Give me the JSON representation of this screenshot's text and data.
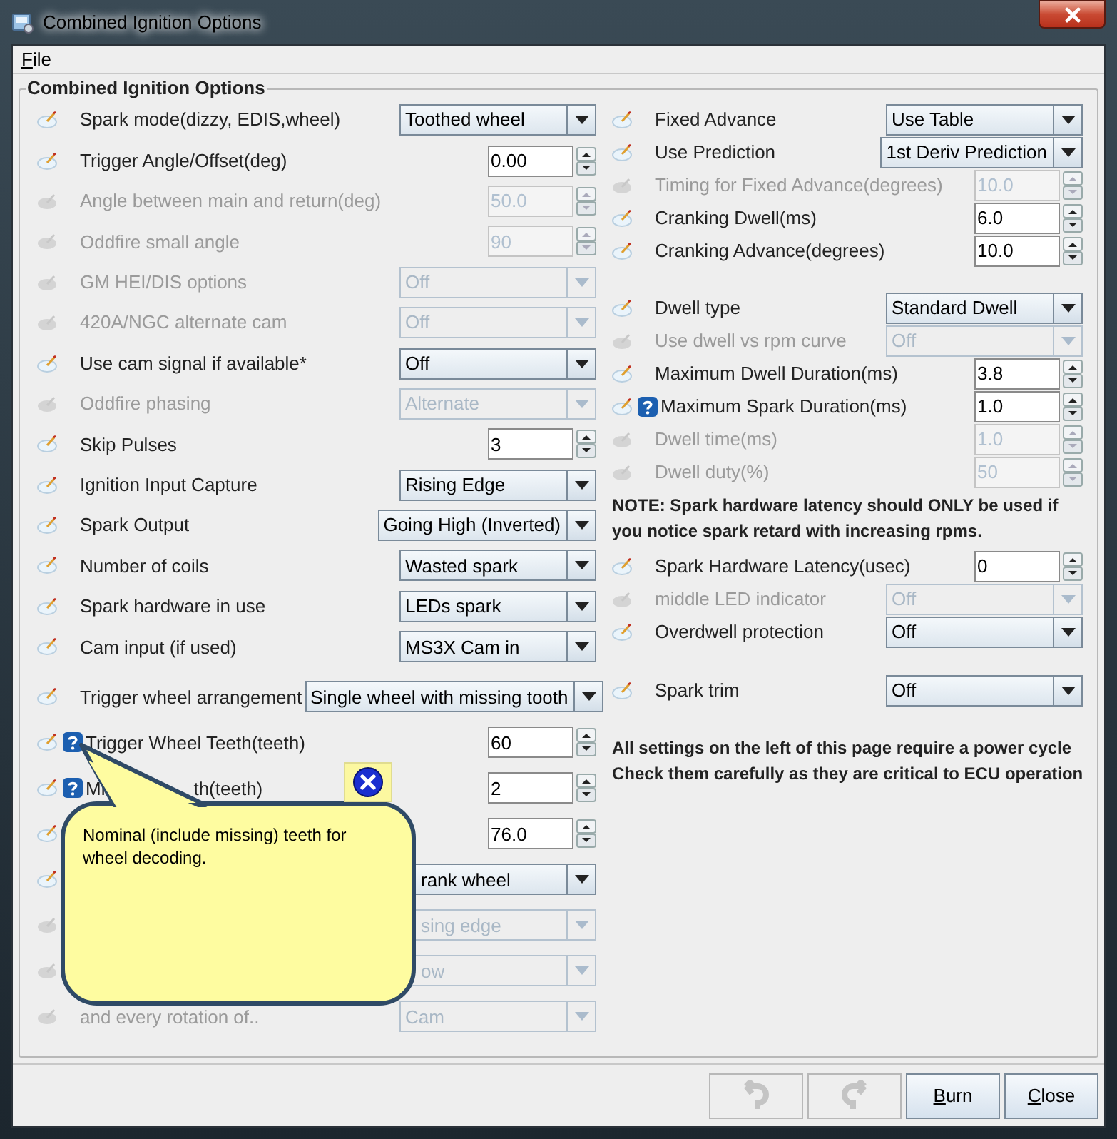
{
  "window": {
    "title": "Combined Ignition Options"
  },
  "menu": [
    {
      "label": "File",
      "underline_first": true
    }
  ],
  "group_title": "Combined Ignition Options",
  "left_groups": [
    [
      {
        "label": "Spark mode(dizzy, EDIS,wheel)",
        "enabled": true,
        "help": false,
        "control": {
          "kind": "combo",
          "value": "Toothed wheel"
        }
      },
      {
        "label": "Trigger Angle/Offset(deg)",
        "enabled": true,
        "help": false,
        "control": {
          "kind": "spinner",
          "value": "0.00"
        }
      },
      {
        "label": "Angle between main and return(deg)",
        "enabled": false,
        "help": false,
        "control": {
          "kind": "spinner",
          "value": "50.0"
        }
      },
      {
        "label": "Oddfire small angle",
        "enabled": false,
        "help": false,
        "control": {
          "kind": "spinner",
          "value": "90"
        }
      },
      {
        "label": "GM HEI/DIS options",
        "enabled": false,
        "help": false,
        "control": {
          "kind": "combo",
          "value": "Off"
        }
      },
      {
        "label": "420A/NGC alternate cam",
        "enabled": false,
        "help": false,
        "control": {
          "kind": "combo",
          "value": "Off"
        }
      },
      {
        "label": "Use cam signal if available*",
        "enabled": true,
        "help": false,
        "control": {
          "kind": "combo",
          "value": "Off"
        }
      },
      {
        "label": "Oddfire phasing",
        "enabled": false,
        "help": false,
        "control": {
          "kind": "combo",
          "value": "Alternate"
        }
      },
      {
        "label": "Skip Pulses",
        "enabled": true,
        "help": false,
        "control": {
          "kind": "spinner",
          "value": "3"
        }
      },
      {
        "label": "Ignition Input Capture",
        "enabled": true,
        "help": false,
        "control": {
          "kind": "combo",
          "value": "Rising Edge"
        }
      },
      {
        "label": "Spark Output",
        "enabled": true,
        "help": false,
        "control": {
          "kind": "combo",
          "value": "Going High (Inverted)"
        }
      },
      {
        "label": "Number of coils",
        "enabled": true,
        "help": false,
        "control": {
          "kind": "combo",
          "value": "Wasted spark"
        }
      },
      {
        "label": "Spark hardware in use",
        "enabled": true,
        "help": false,
        "control": {
          "kind": "combo",
          "value": "LEDs spark"
        }
      },
      {
        "label": "Cam input (if used)",
        "enabled": true,
        "help": false,
        "control": {
          "kind": "combo",
          "value": "MS3X Cam in"
        }
      }
    ],
    [
      {
        "label": "Trigger wheel arrangement",
        "enabled": true,
        "help": false,
        "control": {
          "kind": "combo",
          "value": "Single wheel with missing tooth"
        }
      },
      {
        "label": "Trigger Wheel Teeth(teeth)",
        "enabled": true,
        "help": true,
        "control": {
          "kind": "spinner",
          "value": "60"
        }
      },
      {
        "label_parts": [
          "Mi",
          "th(teeth)"
        ],
        "enabled": true,
        "help": true,
        "control": {
          "kind": "spinner",
          "value": "2"
        }
      },
      {
        "enabled": true,
        "help": false,
        "control": {
          "kind": "spinner",
          "value": "76.0"
        }
      },
      {
        "enabled": true,
        "help": false,
        "control": {
          "kind": "combo",
          "value": "rank wheel",
          "covered": true
        }
      },
      {
        "enabled": false,
        "help": false,
        "control": {
          "kind": "combo",
          "value": "sing edge",
          "covered": true
        }
      },
      {
        "enabled": false,
        "help": false,
        "control": {
          "kind": "combo",
          "value": "ow",
          "covered": true
        }
      },
      {
        "label": "and every rotation of..",
        "enabled": false,
        "help": false,
        "control": {
          "kind": "combo",
          "value": "Cam"
        }
      }
    ]
  ],
  "right_sections": [
    {
      "rows": [
        {
          "label": "Fixed Advance",
          "enabled": true,
          "help": false,
          "control": {
            "kind": "combo",
            "value": "Use Table"
          }
        },
        {
          "label": "Use Prediction",
          "enabled": true,
          "help": false,
          "control": {
            "kind": "combo",
            "value": "1st Deriv Prediction"
          }
        },
        {
          "label": "Timing for Fixed Advance(degrees)",
          "enabled": false,
          "help": false,
          "control": {
            "kind": "spinner",
            "value": "10.0"
          }
        },
        {
          "label": "Cranking Dwell(ms)",
          "enabled": true,
          "help": false,
          "control": {
            "kind": "spinner",
            "value": "6.0"
          }
        },
        {
          "label": "Cranking Advance(degrees)",
          "enabled": true,
          "help": false,
          "control": {
            "kind": "spinner",
            "value": "10.0"
          }
        }
      ]
    },
    {
      "rows": [
        {
          "label": "Dwell type",
          "enabled": true,
          "help": false,
          "control": {
            "kind": "combo",
            "value": "Standard Dwell"
          }
        },
        {
          "label": "Use dwell vs rpm curve",
          "enabled": false,
          "help": false,
          "control": {
            "kind": "combo",
            "value": "Off"
          }
        },
        {
          "label": "Maximum Dwell Duration(ms)",
          "enabled": true,
          "help": false,
          "control": {
            "kind": "spinner",
            "value": "3.8"
          }
        },
        {
          "label": "Maximum Spark Duration(ms)",
          "enabled": true,
          "help": true,
          "control": {
            "kind": "spinner",
            "value": "1.0"
          }
        },
        {
          "label": "Dwell time(ms)",
          "enabled": false,
          "help": false,
          "control": {
            "kind": "spinner",
            "value": "1.0"
          }
        },
        {
          "label": "Dwell duty(%)",
          "enabled": false,
          "help": false,
          "control": {
            "kind": "spinner",
            "value": "50"
          }
        }
      ],
      "notes": [
        "NOTE: Spark hardware latency should ONLY be used if you notice spark retard with increasing rpms."
      ]
    },
    {
      "rows": [
        {
          "label": "Spark Hardware Latency(usec)",
          "enabled": true,
          "help": false,
          "control": {
            "kind": "spinner",
            "value": "0"
          }
        },
        {
          "label": "middle LED indicator",
          "enabled": false,
          "help": false,
          "control": {
            "kind": "combo",
            "value": "Off"
          }
        },
        {
          "label": "Overdwell protection",
          "enabled": true,
          "help": false,
          "control": {
            "kind": "combo",
            "value": "Off"
          }
        }
      ]
    },
    {
      "rows": [
        {
          "label": "Spark trim",
          "enabled": true,
          "help": false,
          "control": {
            "kind": "combo",
            "value": "Off"
          }
        }
      ],
      "notes": [
        "All settings on the left of this page require a power cycle",
        "Check them carefully as they are critical to ECU operation"
      ]
    }
  ],
  "tooltip": {
    "text": "Nominal (include missing) teeth for wheel decoding."
  },
  "buttons": [
    {
      "kind": "undo",
      "enabled": false
    },
    {
      "kind": "redo",
      "enabled": false
    },
    {
      "kind": "text",
      "label": "Burn",
      "underline_first": true,
      "enabled": true
    },
    {
      "kind": "text",
      "label": "Close",
      "underline_first": true,
      "enabled": true
    }
  ]
}
